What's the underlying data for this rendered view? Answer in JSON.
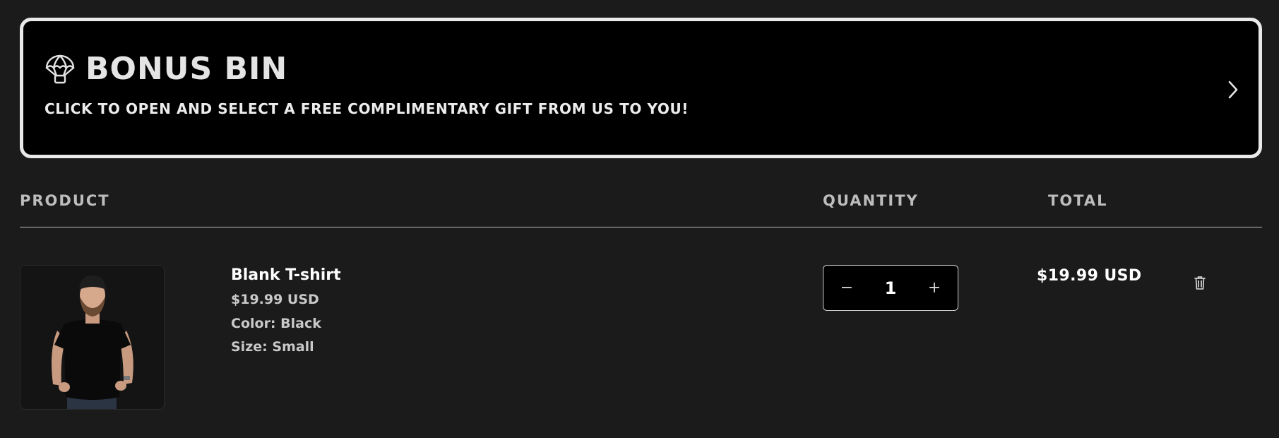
{
  "bonus_bin": {
    "title": "BONUS BIN",
    "subtitle": "CLICK TO OPEN AND SELECT A FREE COMPLIMENTARY GIFT FROM US TO YOU!",
    "icon": "parachute-icon",
    "chevron_icon": "chevron-right-icon"
  },
  "table": {
    "headers": {
      "product": "PRODUCT",
      "quantity": "QUANTITY",
      "total": "TOTAL"
    }
  },
  "cart": {
    "items": [
      {
        "name": "Blank T-shirt",
        "price": "$19.99 USD",
        "color": "Color: Black",
        "size": "Size: Small",
        "quantity": "1",
        "line_total": "$19.99 USD",
        "image": "man-in-black-t-shirt",
        "decrease_symbol": "−",
        "increase_symbol": "+"
      }
    ]
  },
  "colors": {
    "background": "#1b1b1b",
    "banner_background": "#000000",
    "banner_border": "#e9e9e9",
    "text_primary": "#ffffff",
    "text_muted": "#c9c9c9"
  }
}
